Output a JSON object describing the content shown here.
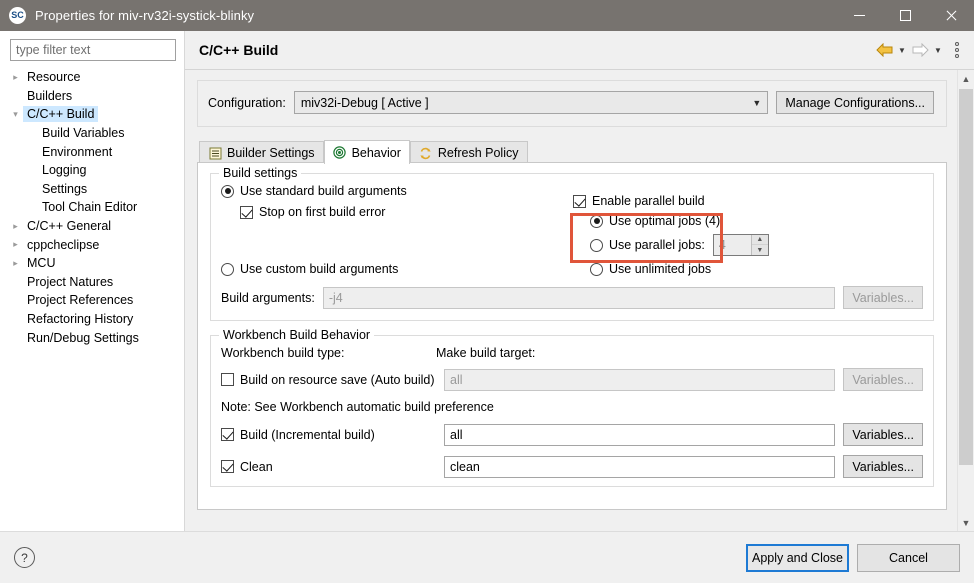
{
  "window": {
    "title": "Properties for miv-rv32i-systick-blinky",
    "app_icon": "softconsole-sc-icon",
    "minimize_label": "Minimize",
    "maximize_label": "Maximize",
    "close_label": "Close"
  },
  "sidebar": {
    "filter_placeholder": "type filter text",
    "filter_value": "",
    "items": [
      {
        "label": "Resource",
        "expandable": true,
        "expanded": false,
        "child": false,
        "selected": false
      },
      {
        "label": "Builders",
        "expandable": false,
        "expanded": false,
        "child": false,
        "selected": false
      },
      {
        "label": "C/C++ Build",
        "expandable": true,
        "expanded": true,
        "child": false,
        "selected": true
      },
      {
        "label": "Build Variables",
        "expandable": false,
        "expanded": false,
        "child": true,
        "selected": false
      },
      {
        "label": "Environment",
        "expandable": false,
        "expanded": false,
        "child": true,
        "selected": false
      },
      {
        "label": "Logging",
        "expandable": false,
        "expanded": false,
        "child": true,
        "selected": false
      },
      {
        "label": "Settings",
        "expandable": false,
        "expanded": false,
        "child": true,
        "selected": false
      },
      {
        "label": "Tool Chain Editor",
        "expandable": false,
        "expanded": false,
        "child": true,
        "selected": false
      },
      {
        "label": "C/C++ General",
        "expandable": true,
        "expanded": false,
        "child": false,
        "selected": false
      },
      {
        "label": "cppcheclipse",
        "expandable": true,
        "expanded": false,
        "child": false,
        "selected": false
      },
      {
        "label": "MCU",
        "expandable": true,
        "expanded": false,
        "child": false,
        "selected": false
      },
      {
        "label": "Project Natures",
        "expandable": false,
        "expanded": false,
        "child": false,
        "selected": false
      },
      {
        "label": "Project References",
        "expandable": false,
        "expanded": false,
        "child": false,
        "selected": false
      },
      {
        "label": "Refactoring History",
        "expandable": false,
        "expanded": false,
        "child": false,
        "selected": false
      },
      {
        "label": "Run/Debug Settings",
        "expandable": false,
        "expanded": false,
        "child": false,
        "selected": false
      }
    ]
  },
  "header": {
    "title": "C/C++ Build",
    "back_icon": "back-arrow-icon",
    "back_caret": "▼",
    "forward_icon": "forward-arrow-icon",
    "forward_caret": "▼",
    "menu_icon": "vertical-dots-menu-icon"
  },
  "configuration": {
    "label": "Configuration:",
    "value": "miv32i-Debug  [ Active ]",
    "dropdown_icon": "chevron-down-icon",
    "manage_button": "Manage Configurations..."
  },
  "tabs": [
    {
      "label": "Builder Settings",
      "icon": "list-lines-icon",
      "active": false
    },
    {
      "label": "Behavior",
      "icon": "target-circle-icon",
      "active": true
    },
    {
      "label": "Refresh Policy",
      "icon": "refresh-arrows-icon",
      "active": false
    }
  ],
  "build_settings": {
    "legend": "Build settings",
    "use_standard": {
      "label": "Use standard build arguments",
      "selected": true
    },
    "stop_on_first_error": {
      "label": "Stop on first build error",
      "checked": true
    },
    "use_custom": {
      "label": "Use custom build arguments",
      "selected": false
    },
    "build_arguments": {
      "label": "Build arguments:",
      "value": "-j4",
      "disabled": true,
      "variables_button": "Variables..."
    },
    "parallel": {
      "enable": {
        "label": "Enable parallel build",
        "checked": true
      },
      "optimal": {
        "label": "Use optimal jobs (4)",
        "selected": true
      },
      "parallel_jobs": {
        "label": "Use parallel jobs:",
        "selected": false,
        "value": "4"
      },
      "unlimited": {
        "label": "Use unlimited jobs",
        "selected": false
      },
      "spinner_up_icon": "spinner-up-icon",
      "spinner_down_icon": "spinner-down-icon"
    }
  },
  "workbench": {
    "legend": "Workbench Build Behavior",
    "build_type_label": "Workbench build type:",
    "make_target_label": "Make build target:",
    "note": "Note: See Workbench automatic build preference",
    "rows": [
      {
        "label": "Build on resource save (Auto build)",
        "checked": false,
        "value": "all",
        "disabled": true,
        "button": "Variables..."
      },
      {
        "label": "Build (Incremental build)",
        "checked": true,
        "value": "all",
        "disabled": false,
        "button": "Variables..."
      },
      {
        "label": "Clean",
        "checked": true,
        "value": "clean",
        "disabled": false,
        "button": "Variables..."
      }
    ]
  },
  "footer": {
    "help_icon": "help-question-icon",
    "apply_and_close": "Apply and Close",
    "cancel": "Cancel"
  },
  "scrollbar": {
    "up_icon": "scroll-up-icon",
    "down_icon": "scroll-down-icon"
  },
  "colors": {
    "titlebar": "#77736f",
    "annotation": "#e0553a",
    "selection": "#cde8ff",
    "default_button_border": "#1e7ad4",
    "back_arrow": "#e0a92b"
  }
}
